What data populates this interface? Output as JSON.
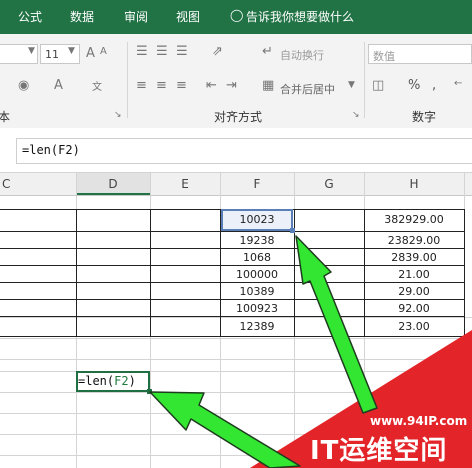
{
  "ribbon_tabs": [
    "公式",
    "数据",
    "审阅",
    "视图"
  ],
  "tell_me": "告诉我你想要做什么",
  "ribbon": {
    "font_size": "11",
    "wrap_text": "自动换行",
    "merge_center": "合并后居中",
    "number_format": "数值",
    "percent": "%",
    "comma": ",",
    "group_font_partial": "本",
    "group_alignment": "对齐方式",
    "group_number": "数字"
  },
  "formula_bar": {
    "value": "=len(F2)"
  },
  "columns": [
    "C",
    "D",
    "E",
    "F",
    "G",
    "H"
  ],
  "column_f": [
    "10023",
    "19238",
    "1068",
    "100000",
    "10389",
    "100923",
    "12389"
  ],
  "column_h": [
    "382929.00",
    "23829.00",
    "2839.00",
    "21.00",
    "29.00",
    "92.00",
    "23.00"
  ],
  "edit_cell": {
    "prefix": "=len(",
    "ref": "F2",
    "suffix": ")"
  },
  "watermark": {
    "url": "www.94IP.com",
    "text": "IT运维空间"
  },
  "colors": {
    "ribbon_green": "#217346",
    "arrow_green": "#32e632",
    "watermark_red": "#e3252a"
  }
}
